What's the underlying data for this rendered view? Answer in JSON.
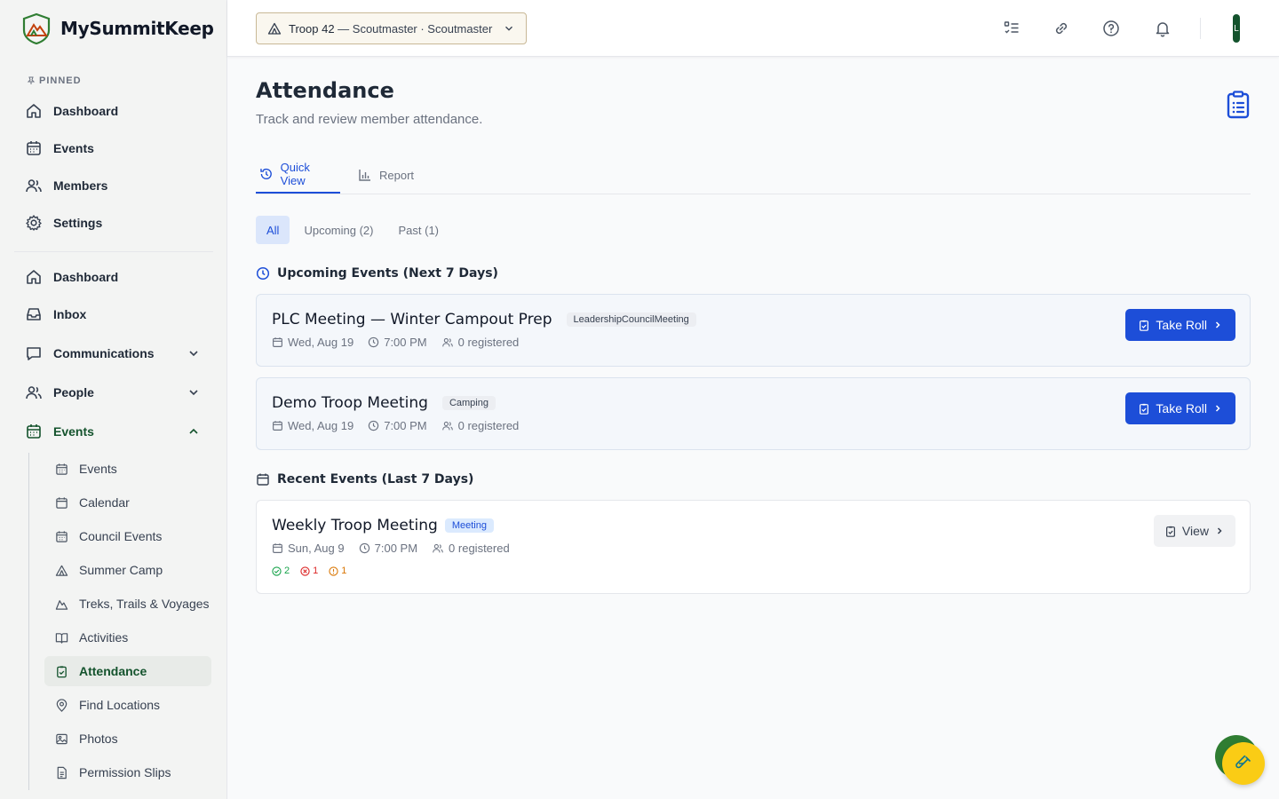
{
  "brand": {
    "name": "MySummitKeep"
  },
  "sidebar": {
    "pinned_label": "PINNED",
    "pinned": [
      {
        "label": "Dashboard",
        "icon": "home-icon"
      },
      {
        "label": "Events",
        "icon": "calendar-icon"
      },
      {
        "label": "Members",
        "icon": "users-icon"
      },
      {
        "label": "Settings",
        "icon": "gear-icon"
      }
    ],
    "main": [
      {
        "label": "Dashboard",
        "icon": "home-icon"
      },
      {
        "label": "Inbox",
        "icon": "inbox-icon"
      },
      {
        "label": "Communications",
        "icon": "chat-icon",
        "expand": "down"
      },
      {
        "label": "People",
        "icon": "users-icon",
        "expand": "down"
      },
      {
        "label": "Events",
        "icon": "calendar-icon",
        "expand": "up"
      }
    ],
    "events_sub": [
      {
        "label": "Events",
        "icon": "calendar-grid-icon"
      },
      {
        "label": "Calendar",
        "icon": "calendar-icon"
      },
      {
        "label": "Council Events",
        "icon": "calendar-grid-icon"
      },
      {
        "label": "Summer Camp",
        "icon": "tent-icon"
      },
      {
        "label": "Treks, Trails & Voyages",
        "icon": "mountain-icon"
      },
      {
        "label": "Activities",
        "icon": "book-icon"
      },
      {
        "label": "Attendance",
        "icon": "clipboard-check-icon",
        "active": true
      },
      {
        "label": "Find Locations",
        "icon": "map-pin-icon"
      },
      {
        "label": "Photos",
        "icon": "image-icon"
      },
      {
        "label": "Permission Slips",
        "icon": "document-icon"
      }
    ]
  },
  "topbar": {
    "troop": "Troop 42",
    "role": " — Scoutmaster · Scoutmaster",
    "avatar": "L"
  },
  "page": {
    "title": "Attendance",
    "subtitle": "Track and review member attendance."
  },
  "tabs": [
    {
      "label": "Quick View",
      "active": true
    },
    {
      "label": "Report",
      "active": false
    }
  ],
  "filters": [
    {
      "label": "All",
      "active": true
    },
    {
      "label": "Upcoming (2)",
      "active": false
    },
    {
      "label": "Past (1)",
      "active": false
    }
  ],
  "upcoming": {
    "heading": "Upcoming Events (Next 7 Days)",
    "events": [
      {
        "title": "PLC Meeting — Winter Campout Prep",
        "badge": "LeadershipCouncilMeeting",
        "date": "Wed, Aug 19",
        "time": "7:00 PM",
        "registered": "0 registered",
        "action": "Take Roll"
      },
      {
        "title": "Demo Troop Meeting",
        "badge": "Camping",
        "date": "Wed, Aug 19",
        "time": "7:00 PM",
        "registered": "0 registered",
        "action": "Take Roll"
      }
    ]
  },
  "recent": {
    "heading": "Recent Events (Last 7 Days)",
    "events": [
      {
        "title": "Weekly Troop Meeting",
        "badge": "Meeting",
        "date": "Sun, Aug 9",
        "time": "7:00 PM",
        "registered": "0 registered",
        "action": "View",
        "present": "2",
        "absent": "1",
        "excused": "1"
      }
    ]
  },
  "colors": {
    "primary": "#1d4ed8",
    "brand_green": "#14532d",
    "fab": "#facc15"
  }
}
